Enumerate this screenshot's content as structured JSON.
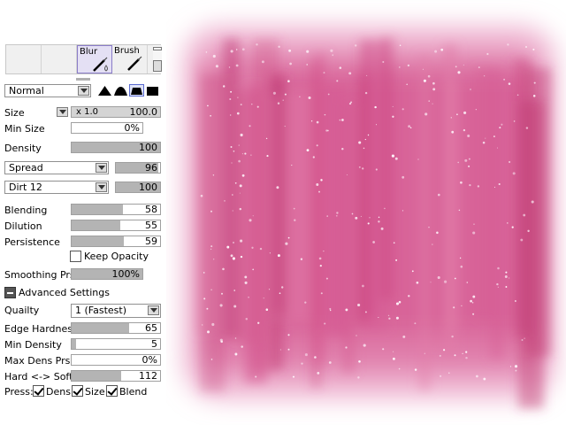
{
  "brush_slots": [
    {
      "name": "",
      "selected": false
    },
    {
      "name": "",
      "selected": false
    },
    {
      "name": "Blur",
      "selected": true
    },
    {
      "name": "Brush",
      "selected": false
    }
  ],
  "blend_mode": "Normal",
  "shapes": [
    "hard",
    "medium",
    "soft-selected",
    "square"
  ],
  "size": {
    "label": "Size",
    "multiplier": "x 1.0",
    "value": "100.0"
  },
  "min_size": {
    "label": "Min Size",
    "value": "0%"
  },
  "density": {
    "label": "Density",
    "value": "100",
    "level": 1.0
  },
  "texture1": {
    "mode": "Spread",
    "value": "96",
    "level": 0.96
  },
  "texture2": {
    "mode": "Dirt 12",
    "value": "100",
    "level": 1.0
  },
  "blending": {
    "label": "Blending",
    "value": "58",
    "level": 0.58
  },
  "dilution": {
    "label": "Dilution",
    "value": "55",
    "level": 0.55
  },
  "persistence": {
    "label": "Persistence",
    "value": "59",
    "level": 0.59
  },
  "keep_opacity": {
    "label": "Keep Opacity",
    "checked": false
  },
  "smoothing": {
    "label": "Smoothing Prs",
    "value": "100%",
    "level": 1.0
  },
  "advanced": {
    "label": "Advanced Settings",
    "expanded": true
  },
  "quality": {
    "label": "Quailty",
    "value": "1 (Fastest)"
  },
  "edge_hardness": {
    "label": "Edge Hardness",
    "value": "65",
    "level": 0.65
  },
  "min_density": {
    "label": "Min Density",
    "value": "5",
    "level": 0.05
  },
  "max_dens_prs": {
    "label": "Max Dens Prs.",
    "value": "0%"
  },
  "hard_soft": {
    "label": "Hard <-> Soft",
    "value": "112",
    "level": 0.56
  },
  "press": {
    "label": "Press:",
    "dens": {
      "label": "Dens",
      "checked": true
    },
    "size": {
      "label": "Size",
      "checked": true
    },
    "blend": {
      "label": "Blend",
      "checked": true
    }
  },
  "colors": {
    "paint": "#d0467f",
    "paint_light": "#e688b0",
    "slot_selected": "#e4e0f4"
  }
}
